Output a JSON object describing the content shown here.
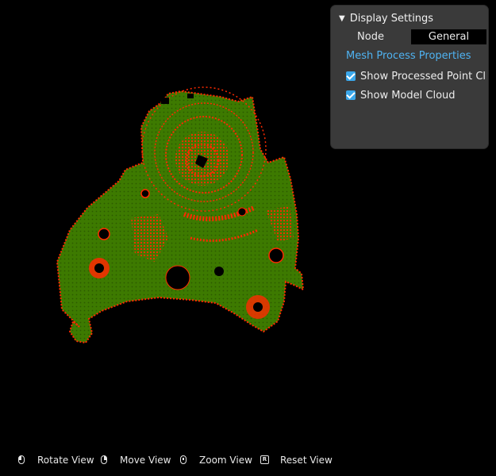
{
  "panel": {
    "title": "Display Settings",
    "tabs": [
      {
        "label": "Node",
        "selected": false
      },
      {
        "label": "General",
        "selected": true
      }
    ],
    "section_title": "Mesh Process Properties",
    "checkboxes": [
      {
        "label": "Show Processed Point Cl",
        "checked": true
      },
      {
        "label": "Show Model Cloud",
        "checked": true
      }
    ]
  },
  "hints": [
    {
      "icon": "mouse-left-icon",
      "label": "Rotate View"
    },
    {
      "icon": "mouse-right-icon",
      "label": "Move View"
    },
    {
      "icon": "mouse-middle-icon",
      "label": "Zoom View"
    },
    {
      "icon": "r-key-icon",
      "key": "R",
      "label": "Reset View"
    }
  ],
  "colors": {
    "mesh_green": "#3f7a00",
    "point_red": "#ff2a00",
    "accent_blue": "#4fb3f2"
  }
}
